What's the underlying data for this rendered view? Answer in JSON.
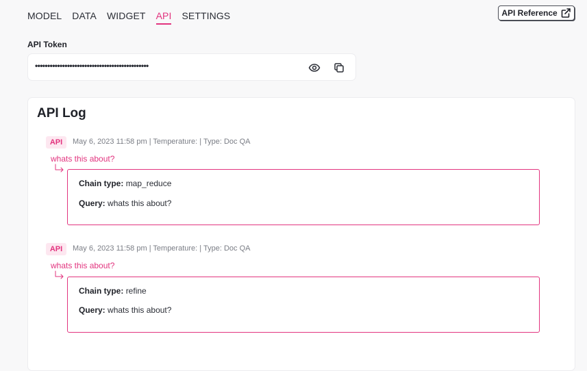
{
  "tabs": [
    {
      "label": "MODEL",
      "active": false
    },
    {
      "label": "DATA",
      "active": false
    },
    {
      "label": "WIDGET",
      "active": false
    },
    {
      "label": "API",
      "active": true
    },
    {
      "label": "SETTINGS",
      "active": false
    }
  ],
  "api_reference": {
    "label": "API Reference",
    "icon": "external-link-icon"
  },
  "token": {
    "label": "API Token",
    "masked_value": "••••••••••••••••••••••••••••••••••••••••••••••",
    "reveal_icon": "eye-icon",
    "copy_icon": "copy-icon"
  },
  "log": {
    "title": "API Log",
    "entries": [
      {
        "badge": "API",
        "meta": "May 6, 2023 11:58 pm | Temperature:  | Type: Doc QA",
        "question": "whats this about?",
        "chain_label": "Chain type:",
        "chain_value": "map_reduce",
        "query_label": "Query:",
        "query_value": "whats this about?"
      },
      {
        "badge": "API",
        "meta": "May 6, 2023 11:58 pm | Temperature:  | Type: Doc QA",
        "question": "whats this about?",
        "chain_label": "Chain type:",
        "chain_value": "refine",
        "query_label": "Query:",
        "query_value": "whats this about?"
      }
    ]
  },
  "colors": {
    "accent": "#e2337e",
    "badge_bg": "#fde7f0",
    "page_bg": "#f8f8f9"
  }
}
